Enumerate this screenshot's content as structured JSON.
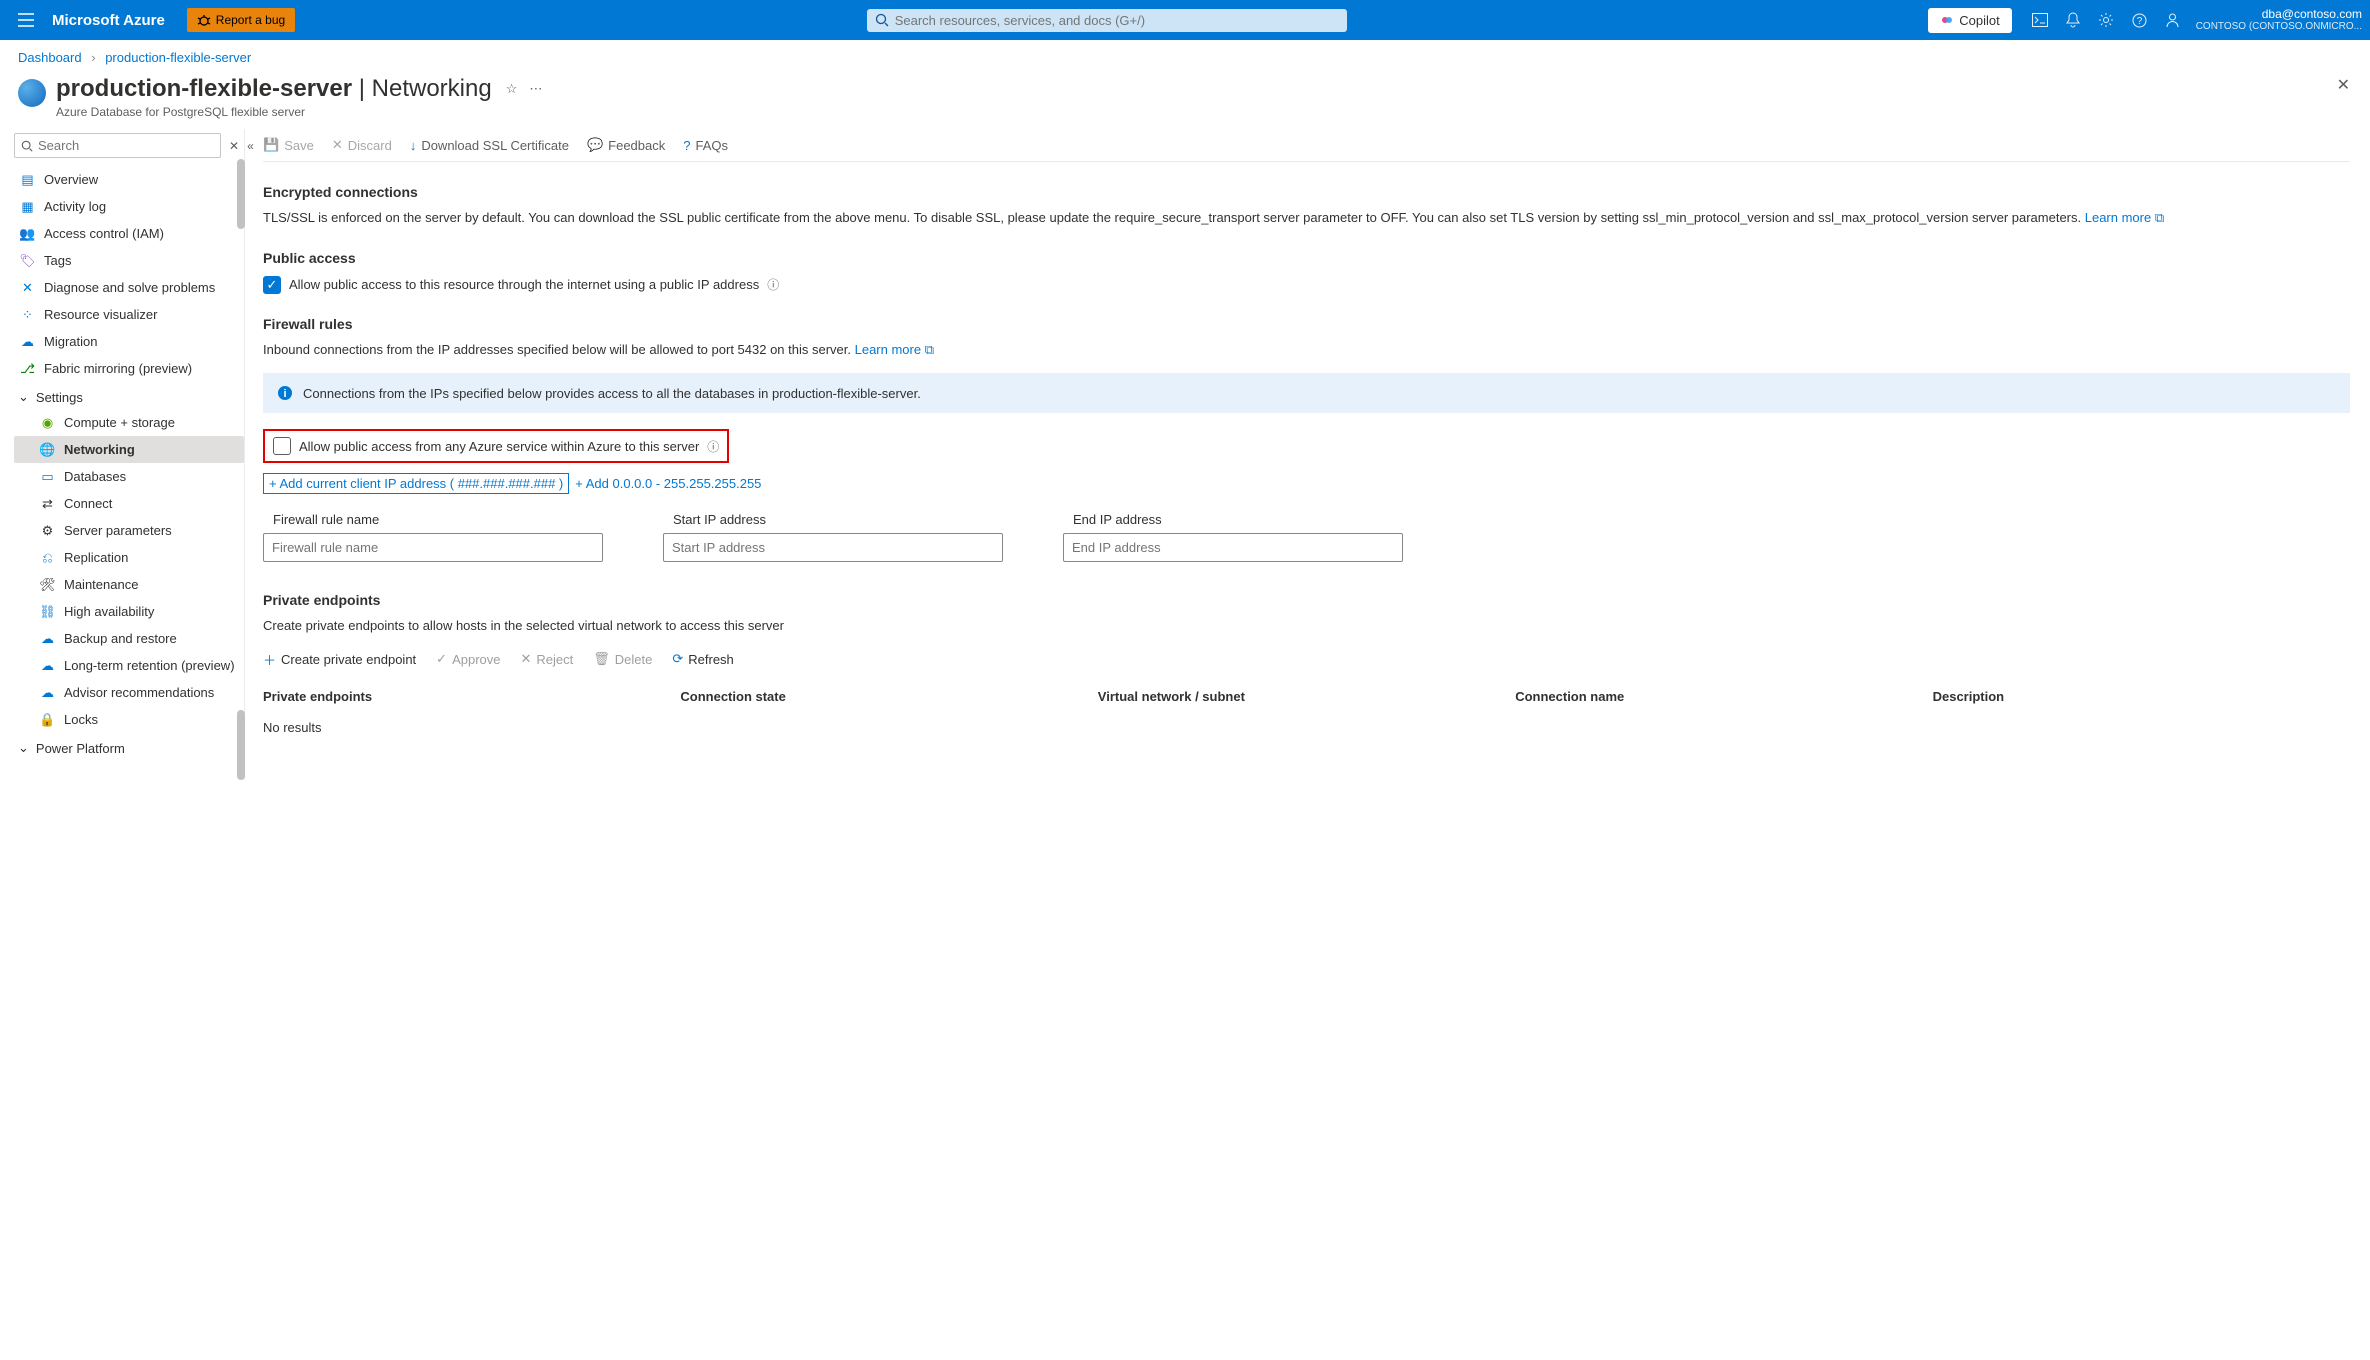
{
  "topbar": {
    "brand": "Microsoft Azure",
    "bug_label": "Report a bug",
    "search_placeholder": "Search resources, services, and docs (G+/)",
    "copilot_label": "Copilot",
    "account_email": "dba@contoso.com",
    "account_tenant": "CONTOSO (CONTOSO.ONMICRO..."
  },
  "breadcrumb": {
    "items": [
      "Dashboard",
      "production-flexible-server"
    ]
  },
  "title": {
    "resource": "production-flexible-server",
    "page": "Networking",
    "subtitle": "Azure Database for PostgreSQL flexible server"
  },
  "sidebar": {
    "search_placeholder": "Search",
    "items": [
      "Overview",
      "Activity log",
      "Access control (IAM)",
      "Tags",
      "Diagnose and solve problems",
      "Resource visualizer",
      "Migration",
      "Fabric mirroring (preview)"
    ],
    "settings_label": "Settings",
    "settings_items": [
      "Compute + storage",
      "Networking",
      "Databases",
      "Connect",
      "Server parameters",
      "Replication",
      "Maintenance",
      "High availability",
      "Backup and restore",
      "Long-term retention (preview)",
      "Advisor recommendations",
      "Locks"
    ],
    "power_platform_label": "Power Platform"
  },
  "cmdbar": {
    "save": "Save",
    "discard": "Discard",
    "download_ssl": "Download SSL Certificate",
    "feedback": "Feedback",
    "faqs": "FAQs"
  },
  "sections": {
    "encrypted_h": "Encrypted connections",
    "encrypted_p": "TLS/SSL is enforced on the server by default. You can download the SSL public certificate from the above menu. To disable SSL, please update the require_secure_transport server parameter to OFF. You can also set TLS version by setting ssl_min_protocol_version and ssl_max_protocol_version server parameters. ",
    "learn_more": "Learn more",
    "public_h": "Public access",
    "public_check_label": "Allow public access to this resource through the internet using a public IP address",
    "firewall_h": "Firewall rules",
    "firewall_p": "Inbound connections from the IP addresses specified below will be allowed to port 5432 on this server. ",
    "banner_text": "Connections from the IPs specified below provides access to all the databases in production-flexible-server.",
    "azure_services_check": "Allow public access from any Azure service within Azure to this server",
    "add_client_ip": "+ Add current client IP address ( ###.###.###.### )",
    "add_range": "+ Add 0.0.0.0 - 255.255.255.255",
    "col_rule_name": "Firewall rule name",
    "ph_rule_name": "Firewall rule name",
    "col_start_ip": "Start IP address",
    "ph_start_ip": "Start IP address",
    "col_end_ip": "End IP address",
    "ph_end_ip": "End IP address",
    "pe_h": "Private endpoints",
    "pe_p": "Create private endpoints to allow hosts in the selected virtual network to access this server",
    "pe_cmds": {
      "create": "Create private endpoint",
      "approve": "Approve",
      "reject": "Reject",
      "delete": "Delete",
      "refresh": "Refresh"
    },
    "pe_cols": [
      "Private endpoints",
      "Connection state",
      "Virtual network / subnet",
      "Connection name",
      "Description"
    ],
    "pe_noresults": "No results"
  }
}
